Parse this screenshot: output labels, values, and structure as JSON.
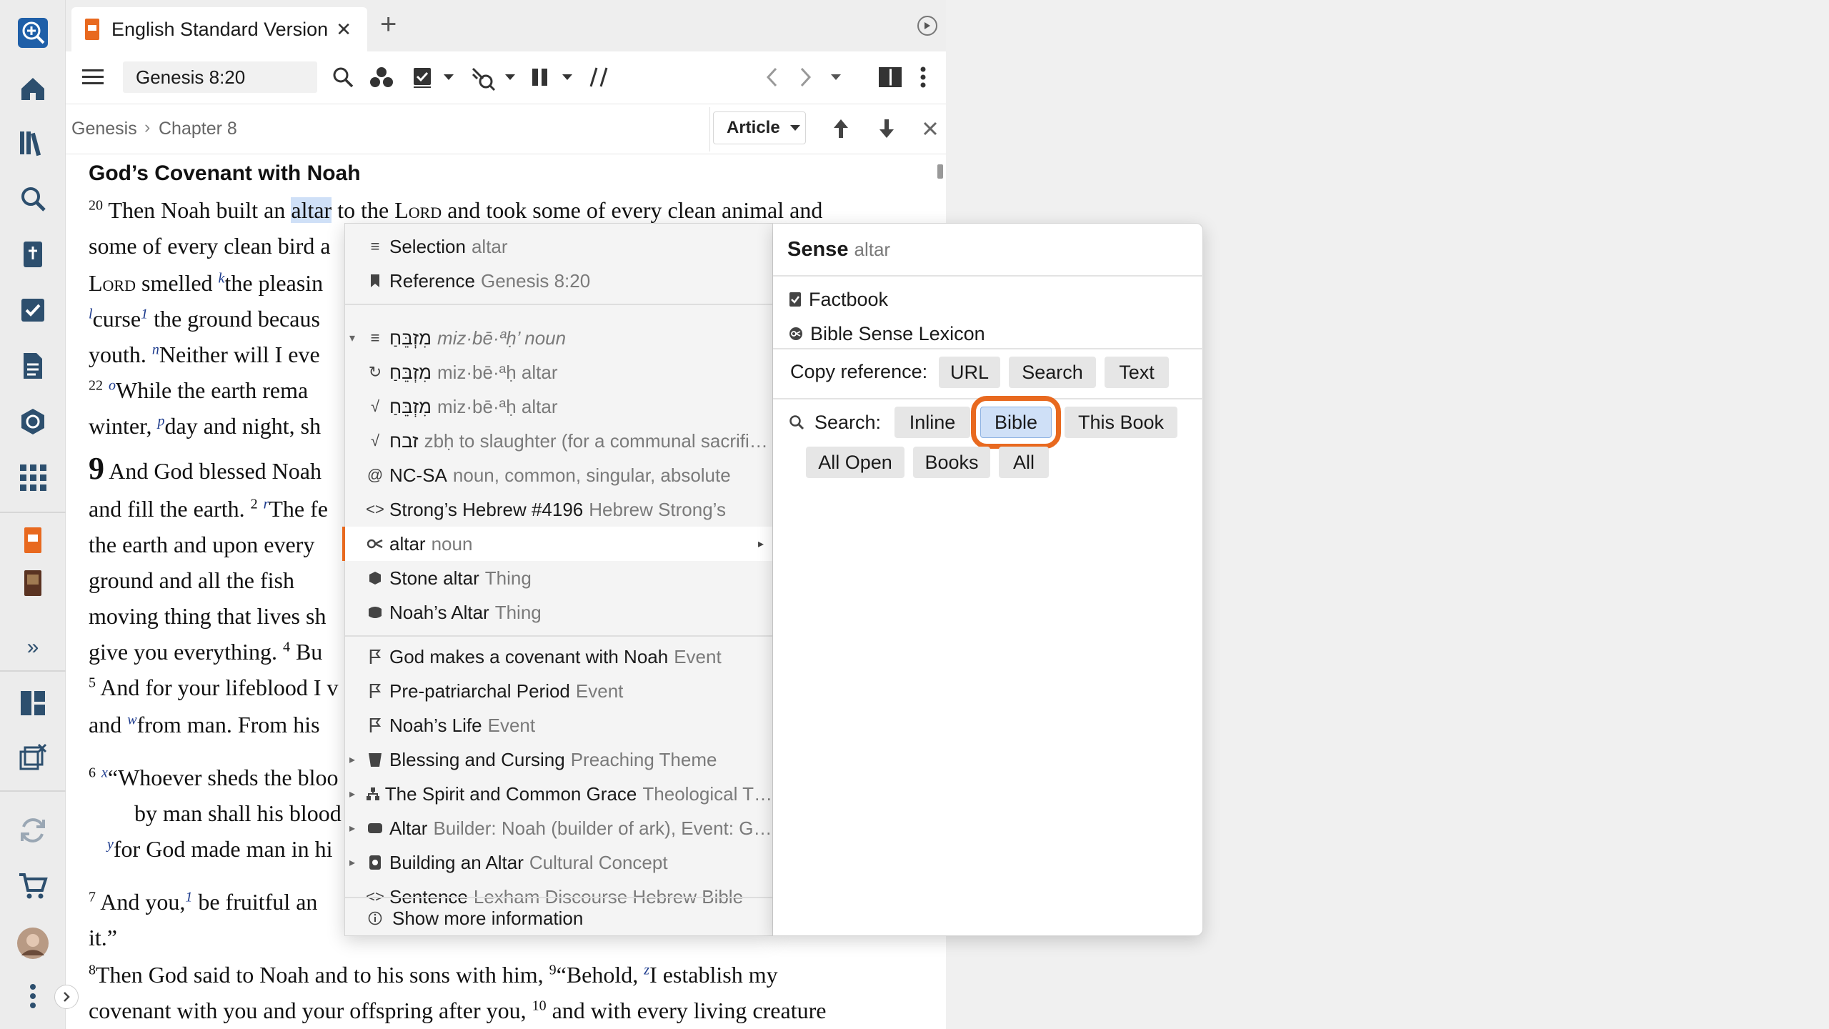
{
  "tab": {
    "title": "English Standard Version",
    "close": "✕",
    "add": "+"
  },
  "toolbar": {
    "reference": "Genesis 8:20"
  },
  "breadcrumb": {
    "book": "Genesis",
    "sep": "›",
    "chapter": "Chapter 8"
  },
  "article_dropdown": {
    "label": "Article"
  },
  "reading": {
    "heading": "God’s Covenant with Noah",
    "lines": {
      "l1a": "Then Noah built an ",
      "l1b": "altar",
      "l1c": " to the ",
      "l1d": "Lord",
      "l1e": " and took some of every clean animal and",
      "l2": "some of every clean bird a",
      "l3a": "Lord",
      "l3b": " smelled ",
      "l3c": "the pleasin",
      "l4a": "curse",
      "l4b": " the ground becaus",
      "l5a": "youth. ",
      "l5b": "Neither will I eve",
      "l6": "While the earth rema",
      "l7a": "winter, ",
      "l7b": "day and night, sh",
      "l8a": "9",
      "l8b": " And God blessed Noah",
      "l9a": "and fill the earth. ",
      "l9b": "The fe",
      "l10": "the earth and upon every",
      "l11": "ground and all the fish",
      "l12": "moving thing that lives sh",
      "l13a": "give you everything. ",
      "l13b": "Bu",
      "l14": " And for your lifeblood I v",
      "l15a": "and ",
      "l15b": "from man. From his",
      "l16": "“Whoever sheds the bloo",
      "l17": "by man shall his blood",
      "l18": "for God made man in hi",
      "l19a": " And you,",
      "l19b": " be fruitful an",
      "l20": "it.”",
      "l21a": "Then God said to Noah and to his sons with him, ",
      "l21b": "“Behold, ",
      "l21c": "I establish my",
      "l22a": "covenant with you and your offspring after you, ",
      "l22b": " and with every living creature"
    },
    "verse_nums": {
      "v20": "20",
      "v22": "22",
      "v2": "2",
      "v4": "4",
      "v5": "5",
      "v6": "6",
      "v7": "7",
      "v8": "8",
      "v9": "9",
      "v10": "10"
    },
    "footnotes": {
      "k": "k",
      "l": "l",
      "n": "n",
      "o": "o",
      "p": "p",
      "r": "r",
      "w": "w",
      "x": "x",
      "y": "y",
      "z": "z",
      "one": "1"
    }
  },
  "menu": {
    "items": [
      {
        "label": "Selection",
        "sub": "altar"
      },
      {
        "label": "Reference",
        "sub": "Genesis 8:20"
      },
      {
        "label": "מִזְבֵּחַ",
        "sub": "miz·bē·ªḥ’ noun"
      },
      {
        "label": "מִזְבֵּחַ",
        "sub": "miz·bē·ªḥ altar"
      },
      {
        "label": "מִזְבֵּחַ",
        "sub": "miz·bē·ªḥ altar"
      },
      {
        "label": "זבח",
        "sub": "zbḥ to slaughter (for a communal sacrifi…"
      },
      {
        "label": "NC-SA",
        "sub": "noun, common, singular, absolute"
      },
      {
        "label": "Strong’s Hebrew #4196",
        "sub": "Hebrew Strong’s"
      },
      {
        "label": "altar",
        "sub": "noun"
      },
      {
        "label": "Stone altar",
        "sub": "Thing"
      },
      {
        "label": "Noah’s Altar",
        "sub": "Thing"
      },
      {
        "label": "God makes a covenant with Noah",
        "sub": "Event"
      },
      {
        "label": "Pre-patriarchal Period",
        "sub": "Event"
      },
      {
        "label": "Noah’s Life",
        "sub": "Event"
      },
      {
        "label": "Blessing and Cursing",
        "sub": "Preaching Theme"
      },
      {
        "label": "The Spirit and Common Grace",
        "sub": "Theological T…"
      },
      {
        "label": "Altar",
        "sub": "Builder: Noah (builder of ark), Event: G…"
      },
      {
        "label": "Building an Altar",
        "sub": "Cultural Concept"
      },
      {
        "label": "Sentence",
        "sub": "Lexham Discourse Hebrew Bible"
      },
      {
        "label": "Show more information",
        "sub": ""
      }
    ]
  },
  "sense": {
    "title": "Sense",
    "title_sub": "altar",
    "links": [
      "Factbook",
      "Bible Sense Lexicon"
    ],
    "copy_label": "Copy reference:",
    "copy_buttons": [
      "URL",
      "Search",
      "Text"
    ],
    "search_label": "Search:",
    "search_buttons": [
      "Inline",
      "Bible",
      "This Book",
      "All Open",
      "Books",
      "All"
    ]
  },
  "colors": {
    "accent": "#e8691f",
    "selected": "#cfe0f7",
    "link": "#1c3a8c",
    "rail_icon": "#2d4f6e"
  }
}
